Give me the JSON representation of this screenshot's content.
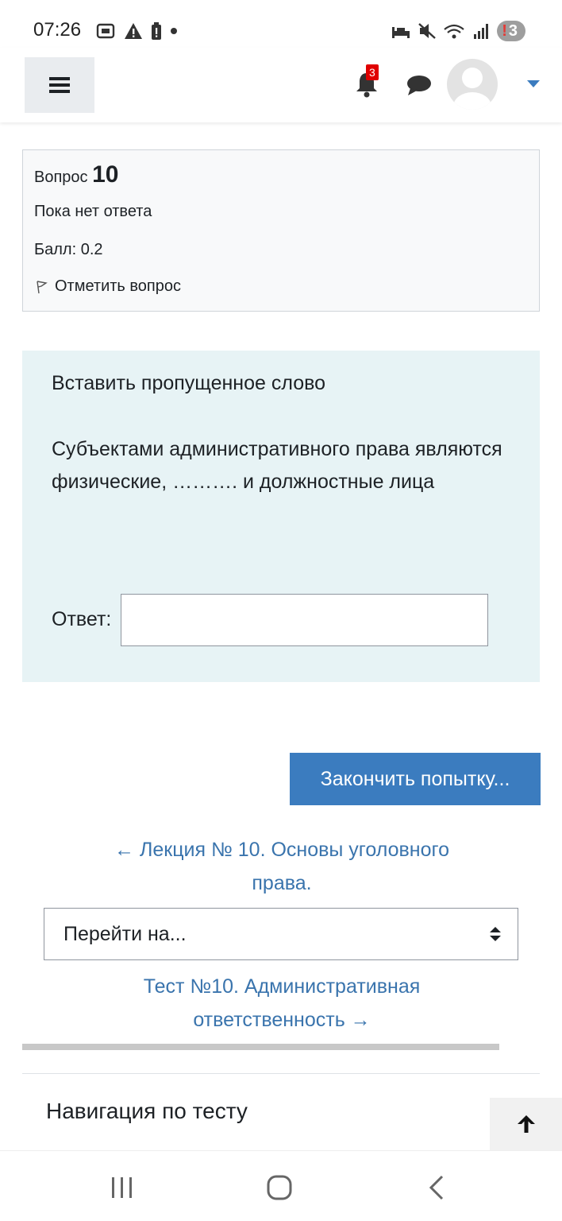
{
  "status_bar": {
    "time": "07:26",
    "badge_exclamation": "!",
    "badge_count": "3"
  },
  "navbar": {
    "notification_count": "3"
  },
  "question_info": {
    "label": "Вопрос",
    "number": "10",
    "state": "Пока нет ответа",
    "grade": "Балл: 0.2",
    "flag_label": "Отметить вопрос"
  },
  "question": {
    "title": "Вставить пропущенное слово",
    "text": "Субъектами административного права являются физические, ………. и должностные лица",
    "answer_label": "Ответ:",
    "answer_value": ""
  },
  "finish_button_label": "Закончить попытку...",
  "prev_activity_link": "← Лекция № 10. Основы уголовного права.",
  "jump_select_value": "Перейти на...",
  "next_activity_link": "Тест №10. Административная ответственность →",
  "quiz_nav_title": "Навигация по тесту",
  "colors": {
    "primary": "#3b7cbf",
    "link": "#3a74ad",
    "question_bg": "#e7f3f5",
    "info_bg": "#f8f9fa",
    "notification": "#e00000"
  }
}
